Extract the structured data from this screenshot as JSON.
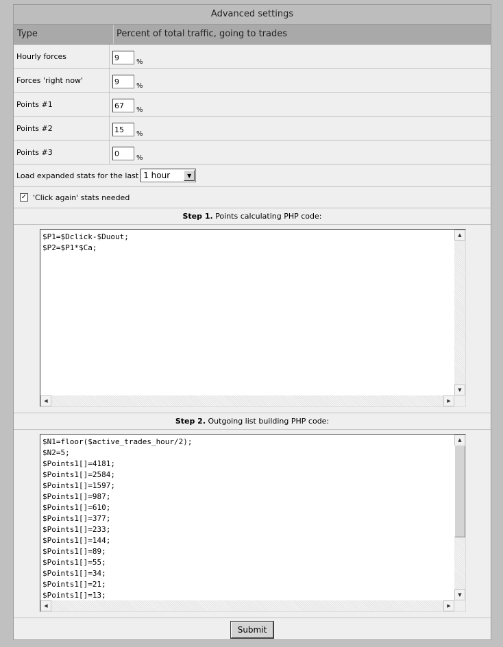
{
  "panel": {
    "title": "Advanced settings",
    "col_type": "Type",
    "col_percent": "Percent of total traffic, going to trades"
  },
  "rows": [
    {
      "label": "Hourly forces",
      "value": "9",
      "unit": "%"
    },
    {
      "label": "Forces 'right now'",
      "value": "9",
      "unit": "%"
    },
    {
      "label": "Points #1",
      "value": "67",
      "unit": "%"
    },
    {
      "label": "Points #2",
      "value": "15",
      "unit": "%"
    },
    {
      "label": "Points #3",
      "value": "0",
      "unit": "%"
    }
  ],
  "load_stats": {
    "label": "Load expanded stats for the last",
    "selected": "1 hour"
  },
  "click_again": {
    "label": "'Click again' stats needed",
    "checked": true
  },
  "step1": {
    "title": "Step 1.",
    "text": "Points calculating PHP code:",
    "code": "$P1=$Dclick-$Duout;\n$P2=$P1*$Ca;"
  },
  "step2": {
    "title": "Step 2.",
    "text": "Outgoing list building PHP code:",
    "code": "$N1=floor($active_trades_hour/2);\n$N2=5;\n$Points1[]=4181;\n$Points1[]=2584;\n$Points1[]=1597;\n$Points1[]=987;\n$Points1[]=610;\n$Points1[]=377;\n$Points1[]=233;\n$Points1[]=144;\n$Points1[]=89;\n$Points1[]=55;\n$Points1[]=34;\n$Points1[]=21;\n$Points1[]=13;"
  },
  "submit_label": "Submit",
  "icons": {
    "arrow_up": "▲",
    "arrow_down": "▼",
    "arrow_left": "◀",
    "arrow_right": "▶",
    "check": "✓"
  }
}
